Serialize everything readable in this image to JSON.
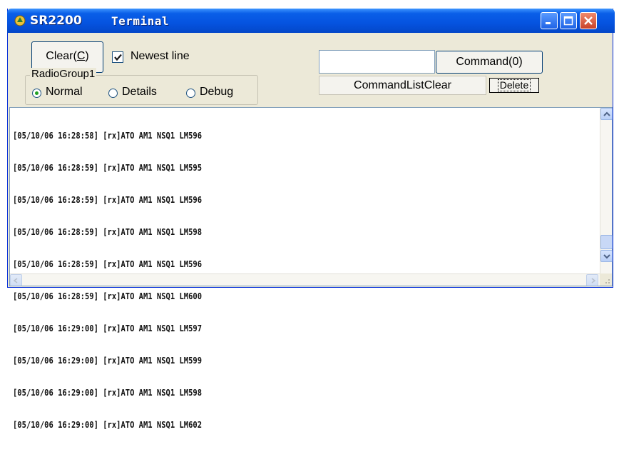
{
  "titlebar": {
    "app_name": "SR2200",
    "title": "Terminal",
    "icon": "app-logo-icon",
    "buttons": [
      "minimize-icon",
      "maximize-icon",
      "close-icon"
    ]
  },
  "toolbar": {
    "clear_label": "Clear(",
    "clear_accel": "C",
    "clear_close": ")",
    "newest_line_label": "Newest line",
    "newest_line_checked": true
  },
  "radio_group": {
    "legend": "RadioGroup1",
    "options": [
      {
        "label": "Normal",
        "selected": true
      },
      {
        "label": "Details",
        "selected": false
      },
      {
        "label": "Debug",
        "selected": false
      }
    ]
  },
  "command": {
    "input_value": "",
    "command_label": "Command(0)",
    "list_clear_label": "CommandListClear",
    "delete_label": "Delete"
  },
  "log": {
    "lines": [
      "[05/10/06 16:28:58] [rx]ATO AM1 NSQ1 LM596",
      "[05/10/06 16:28:59] [rx]ATO AM1 NSQ1 LM595",
      "[05/10/06 16:28:59] [rx]ATO AM1 NSQ1 LM596",
      "[05/10/06 16:28:59] [rx]ATO AM1 NSQ1 LM598",
      "[05/10/06 16:28:59] [rx]ATO AM1 NSQ1 LM596",
      "[05/10/06 16:28:59] [rx]ATO AM1 NSQ1 LM600",
      "[05/10/06 16:29:00] [rx]ATO AM1 NSQ1 LM597",
      "[05/10/06 16:29:00] [rx]ATO AM1 NSQ1 LM599",
      "[05/10/06 16:29:00] [rx]ATO AM1 NSQ1 LM598",
      "[05/10/06 16:29:00] [rx]ATO AM1 NSQ1 LM602"
    ]
  },
  "colors": {
    "titlebar": "#0553e0",
    "window_bg": "#ece9d8",
    "close_button": "#c9422a",
    "radio_dot": "#21a121"
  }
}
